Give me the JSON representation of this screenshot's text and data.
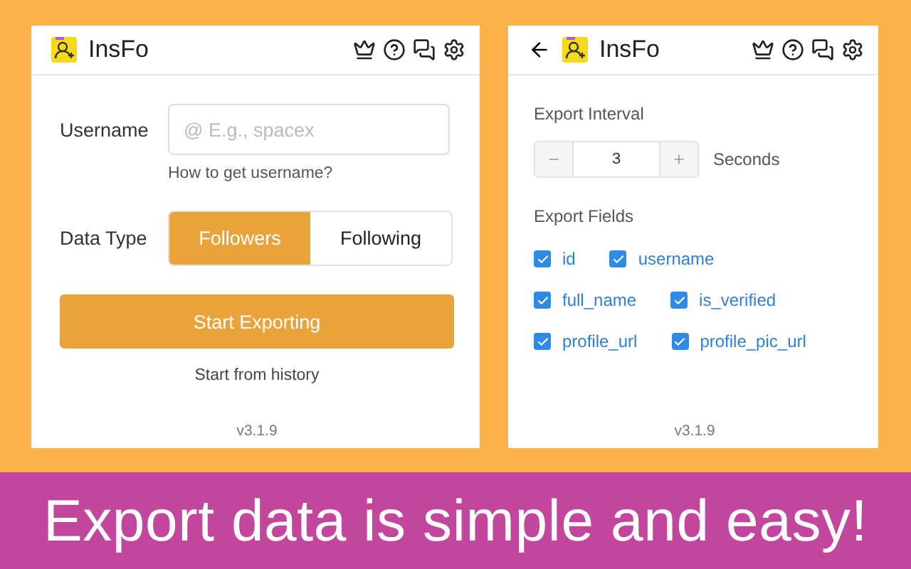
{
  "left_panel": {
    "header": {
      "title": "InsFo"
    },
    "username": {
      "label": "Username",
      "placeholder": "@ E.g., spacex",
      "help_link": "How to get username?"
    },
    "data_type": {
      "label": "Data Type",
      "options": [
        {
          "label": "Followers",
          "selected": true
        },
        {
          "label": "Following",
          "selected": false
        }
      ]
    },
    "start_button": "Start Exporting",
    "history_link": "Start from history",
    "version": "v3.1.9"
  },
  "right_panel": {
    "header": {
      "title": "InsFo"
    },
    "export_interval": {
      "label": "Export Interval",
      "value": "3",
      "unit": "Seconds"
    },
    "export_fields": {
      "label": "Export Fields",
      "rows": [
        [
          {
            "label": "id",
            "checked": true
          },
          {
            "label": "username",
            "checked": true
          }
        ],
        [
          {
            "label": "full_name",
            "checked": true
          },
          {
            "label": "is_verified",
            "checked": true
          }
        ],
        [
          {
            "label": "profile_url",
            "checked": true
          },
          {
            "label": "profile_pic_url",
            "checked": true
          }
        ]
      ]
    },
    "version": "v3.1.9"
  },
  "banner": {
    "text": "Export data is simple and easy!"
  }
}
